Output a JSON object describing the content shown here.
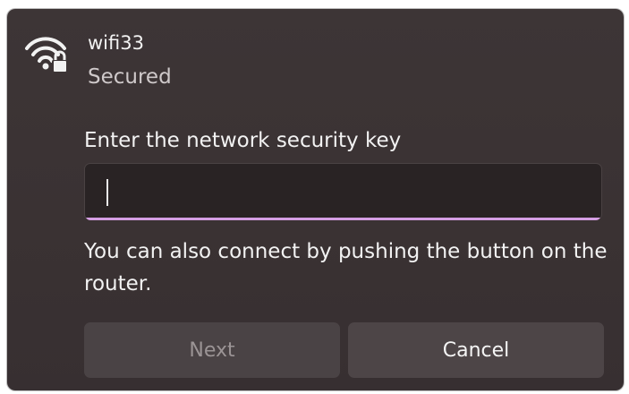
{
  "network": {
    "ssid": "wifi33",
    "status": "Secured",
    "icon": "wifi-secured-icon"
  },
  "form": {
    "prompt": "Enter the network security key",
    "key_value": "",
    "key_placeholder": "",
    "hint": "You can also connect by pushing the button on the router."
  },
  "buttons": {
    "next_label": "Next",
    "cancel_label": "Cancel"
  },
  "colors": {
    "panel_bg": "#3a3233",
    "input_bg": "#292324",
    "accent": "#d59ee3",
    "text": "#f2f2f2",
    "button_bg": "#4d4547",
    "disabled_text": "#9b9495"
  }
}
